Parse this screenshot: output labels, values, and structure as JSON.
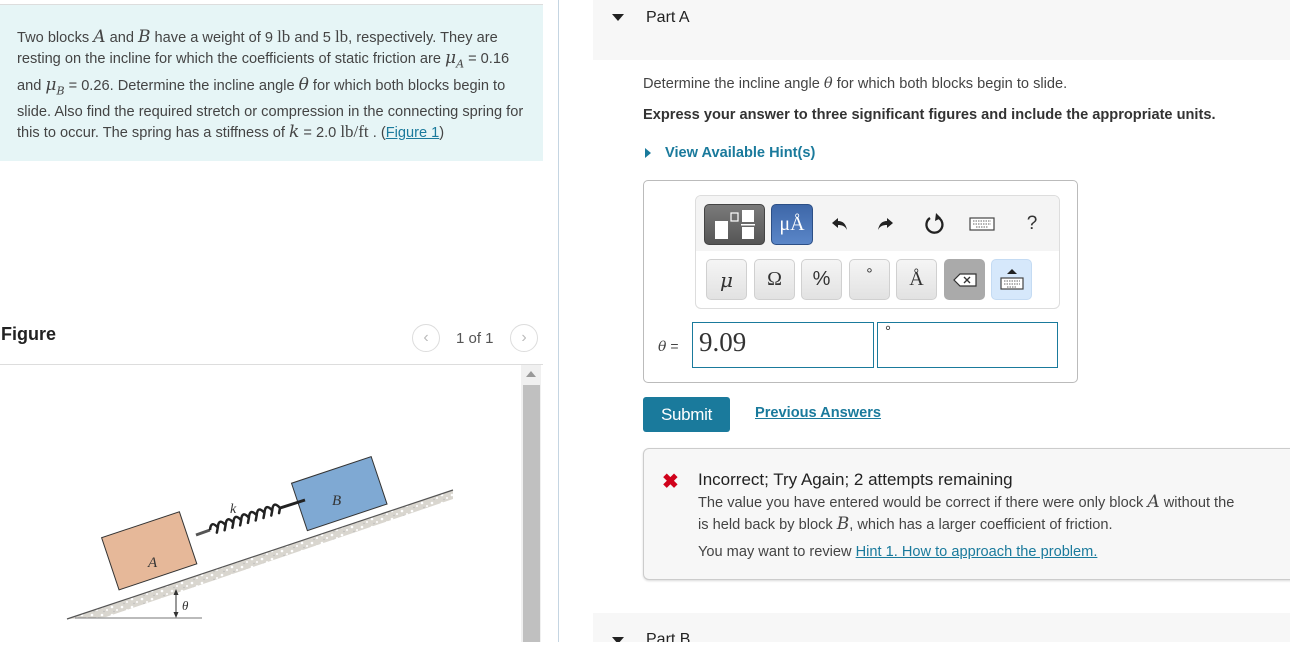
{
  "problem": {
    "segments": [
      {
        "t": "Two blocks "
      },
      {
        "m": "A"
      },
      {
        "t": " and "
      },
      {
        "m": "B"
      },
      {
        "t": " have a weight of 9 "
      },
      {
        "r": "lb"
      },
      {
        "t": " and 5 "
      },
      {
        "r": "lb"
      },
      {
        "t": ", respectively. They are resting on the incline for which the coefficients of static friction are "
      },
      {
        "m": "μ",
        "sub": "A"
      },
      {
        "t": " = 0.16 and "
      },
      {
        "m": "μ",
        "sub": "B"
      },
      {
        "t": " = 0.26. Determine the incline angle "
      },
      {
        "m": "θ"
      },
      {
        "t": " for which both blocks begin to slide. Also find the required stretch or compression in the connecting spring for this to occur. The spring has a stiffness of "
      },
      {
        "m": "k"
      },
      {
        "t": " = 2.0 "
      },
      {
        "r": "lb/ft"
      },
      {
        "t": " . ("
      },
      {
        "link": "Figure 1"
      },
      {
        "t": ")"
      }
    ],
    "figure_link": "Figure 1"
  },
  "figure": {
    "title": "Figure",
    "pager": "1 of 1",
    "prev_icon": "‹",
    "next_icon": "›",
    "labels": {
      "block_a": "A",
      "block_b": "B",
      "spring": "k",
      "angle": "θ"
    },
    "colors": {
      "block_a": "#e6b899",
      "block_b": "#7fa9d3",
      "surface": "#d9d6cf"
    }
  },
  "partA": {
    "title": "Part A",
    "question_pre": "Determine the incline angle ",
    "question_var": "θ",
    "question_post": " for which both blocks begin to slide.",
    "instruction": "Express your answer to three significant figures and include the appropriate units.",
    "hints_label": "View Available Hint(s)",
    "toolbar": {
      "units_label": "μÅ",
      "undo_icon": "↶",
      "redo_icon": "↷",
      "reset_icon": "↻",
      "help_label": "?",
      "symbols": [
        "μ",
        "Ω",
        "%",
        "°",
        "Å"
      ]
    },
    "answer_label": "θ =",
    "answer_value": "9.09",
    "answer_unit": "°",
    "submit_label": "Submit",
    "previous_answers_label": "Previous Answers",
    "feedback": {
      "status": "Incorrect; Try Again; 2 attempts remaining",
      "line1_pre": "The value you have entered would be correct if there were only block ",
      "line1_var": "A",
      "line1_post": " without the",
      "line2_pre": "is held back by block ",
      "line2_var": "B",
      "line2_post": ", which has a larger coefficient of friction.",
      "review_pre": "You may want to review ",
      "review_link": "Hint 1. How to approach the problem."
    }
  },
  "partB": {
    "title": "Part B"
  },
  "colors": {
    "accent": "#1a7a9c",
    "error": "#d0021b",
    "problem_bg": "#e6f5f6",
    "units_btn": "#4a76b8"
  }
}
